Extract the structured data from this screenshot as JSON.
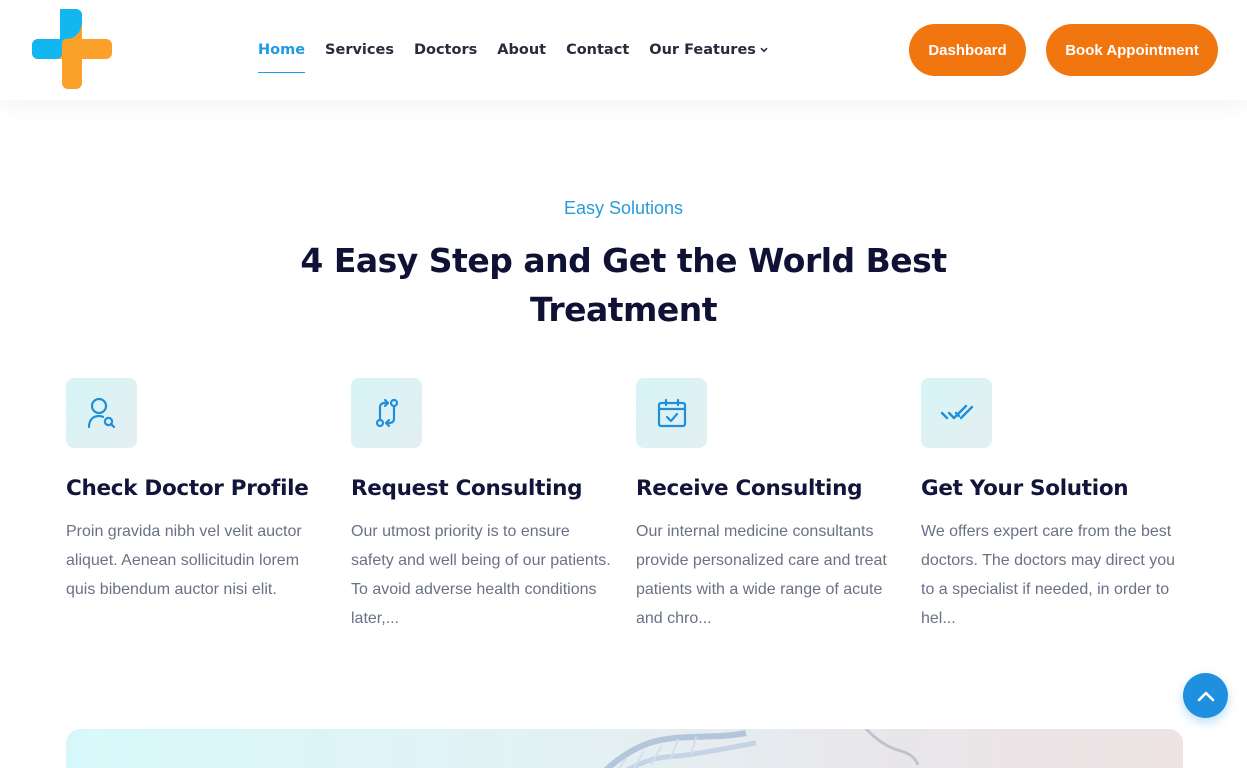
{
  "header": {
    "logo_name": "plus-logo",
    "nav": [
      {
        "label": "Home",
        "active": true
      },
      {
        "label": "Services",
        "active": false
      },
      {
        "label": "Doctors",
        "active": false
      },
      {
        "label": "About",
        "active": false
      },
      {
        "label": "Contact",
        "active": false
      },
      {
        "label": "Our Features",
        "active": false,
        "dropdown": true
      }
    ],
    "dashboard_label": "Dashboard",
    "book_label": "Book Appointment"
  },
  "section": {
    "eyebrow": "Easy Solutions",
    "heading_line1": "4 Easy Step and Get the World Best",
    "heading_line2": "Treatment"
  },
  "steps": [
    {
      "icon": "user-search-icon",
      "title": "Check Doctor Profile",
      "text": "Proin gravida nibh vel velit auctor aliquet. Aenean sollicitudin lorem quis bibendum auctor nisi elit."
    },
    {
      "icon": "git-compare-icon",
      "title": "Request Consulting",
      "text": "Our utmost priority is to ensure safety and well being of our patients. To avoid adverse health conditions later,..."
    },
    {
      "icon": "calendar-check-icon",
      "title": "Receive Consulting",
      "text": "Our internal medicine consultants provide personalized care and treat patients with a wide range of acute and chro..."
    },
    {
      "icon": "double-check-icon",
      "title": "Get Your Solution",
      "text": "We offers expert care from the best doctors. The doctors may direct you to a specialist if needed, in order to hel..."
    }
  ],
  "colors": {
    "accent_blue": "#1f9be6",
    "accent_orange": "#f2760f",
    "logo_blue": "#12b7f2",
    "logo_orange": "#fba12a",
    "heading_dark": "#0f1235"
  }
}
